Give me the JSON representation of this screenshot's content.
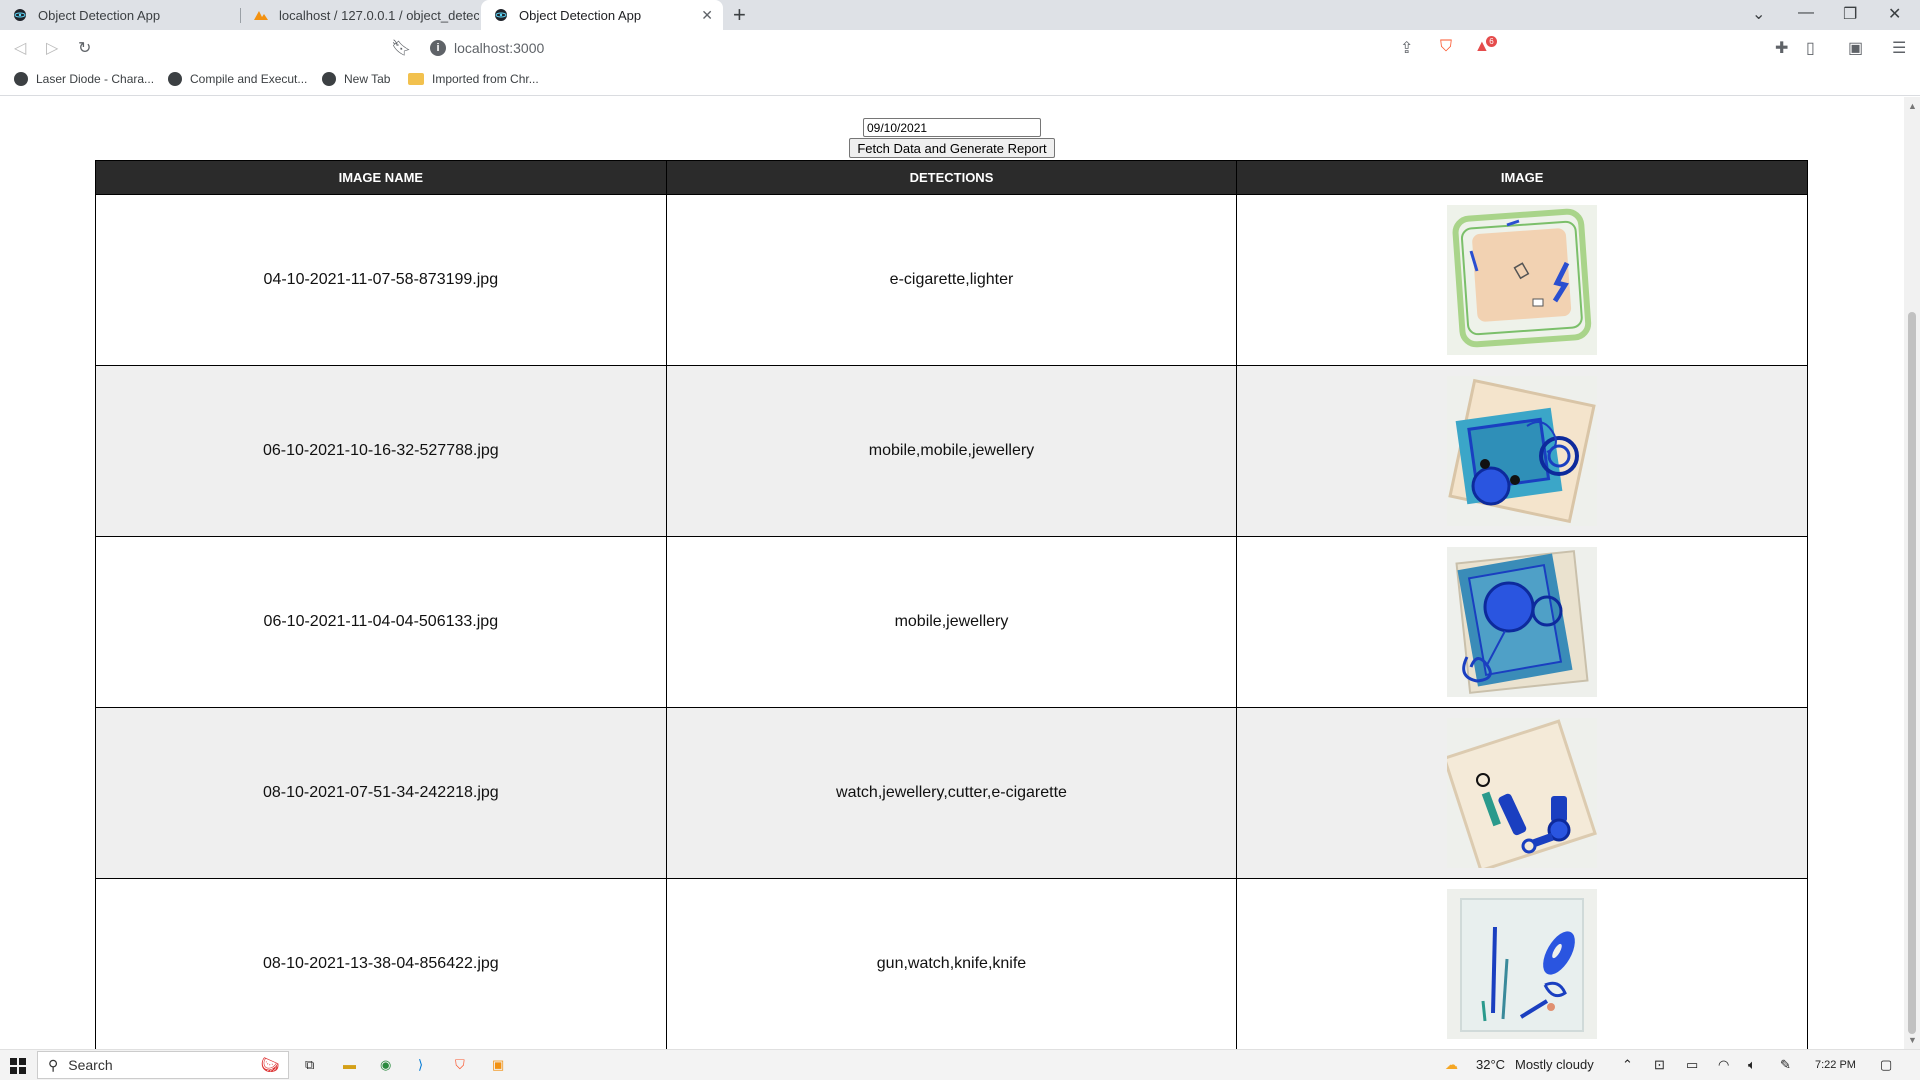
{
  "browser": {
    "tabs": [
      {
        "title": "Object Detection App",
        "active": false
      },
      {
        "title": "localhost / 127.0.0.1 / object_detectio",
        "active": false
      },
      {
        "title": "Object Detection App",
        "active": true
      }
    ],
    "url": "localhost:3000",
    "bookmarks": [
      {
        "label": "Laser Diode - Chara..."
      },
      {
        "label": "Compile and Execut..."
      },
      {
        "label": "New Tab"
      },
      {
        "label": "Imported from Chr..."
      }
    ],
    "extension_badge": "6"
  },
  "form": {
    "date_value": "09/10/2021",
    "fetch_button": "Fetch Data and Generate Report"
  },
  "table": {
    "headers": [
      "IMAGE NAME",
      "DETECTIONS",
      "IMAGE"
    ],
    "rows": [
      {
        "image_name": "04-10-2021-11-07-58-873199.jpg",
        "detections": "e-cigarette,lighter"
      },
      {
        "image_name": "06-10-2021-10-16-32-527788.jpg",
        "detections": "mobile,mobile,jewellery"
      },
      {
        "image_name": "06-10-2021-11-04-04-506133.jpg",
        "detections": "mobile,jewellery"
      },
      {
        "image_name": "08-10-2021-07-51-34-242218.jpg",
        "detections": "watch,jewellery,cutter,e-cigarette"
      },
      {
        "image_name": "08-10-2021-13-38-04-856422.jpg",
        "detections": "gun,watch,knife,knife"
      }
    ]
  },
  "taskbar": {
    "search_label": "Search",
    "weather_temp": "32°C",
    "weather_desc": "Mostly cloudy",
    "time": "7:22 PM"
  }
}
